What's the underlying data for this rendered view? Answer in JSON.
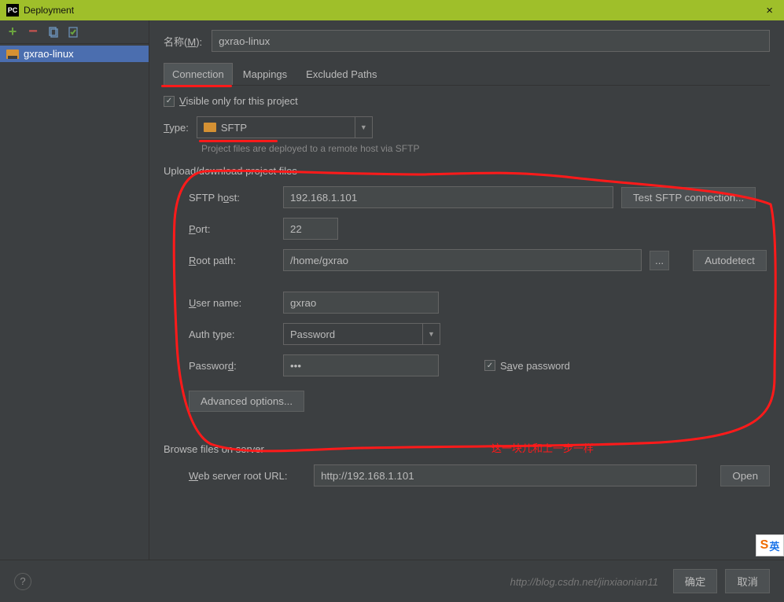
{
  "window": {
    "title": "Deployment",
    "close": "×",
    "app_badge": "PC"
  },
  "left": {
    "selected": "gxrao-linux"
  },
  "name": {
    "label": "名称(M):",
    "value": "gxrao-linux"
  },
  "tabs": {
    "connection": "Connection",
    "mappings": "Mappings",
    "excluded": "Excluded Paths"
  },
  "visible_only": "Visible only for this project",
  "type": {
    "label": "Type:",
    "value": "SFTP",
    "hint": "Project files are deployed to a remote host via SFTP"
  },
  "upload_group": "Upload/download project files",
  "fields": {
    "host_label": "SFTP host:",
    "host": "192.168.1.101",
    "test_btn": "Test SFTP connection...",
    "port_label": "Port:",
    "port": "22",
    "root_label": "Root path:",
    "root": "/home/gxrao",
    "browse_btn": "...",
    "autodetect": "Autodetect",
    "user_label": "User name:",
    "user": "gxrao",
    "auth_label": "Auth type:",
    "auth": "Password",
    "pass_label": "Password:",
    "pass": "•••",
    "save_pass": "Save password",
    "advanced": "Advanced options..."
  },
  "browse": {
    "title": "Browse files on server",
    "url_label": "Web server root URL:",
    "url": "http://192.168.1.101",
    "open": "Open"
  },
  "buttons": {
    "ok": "确定",
    "cancel": "取消"
  },
  "annotation_text": "这一块儿和上一步一样",
  "watermark": "http://blog.csdn.net/jinxiaonian11"
}
